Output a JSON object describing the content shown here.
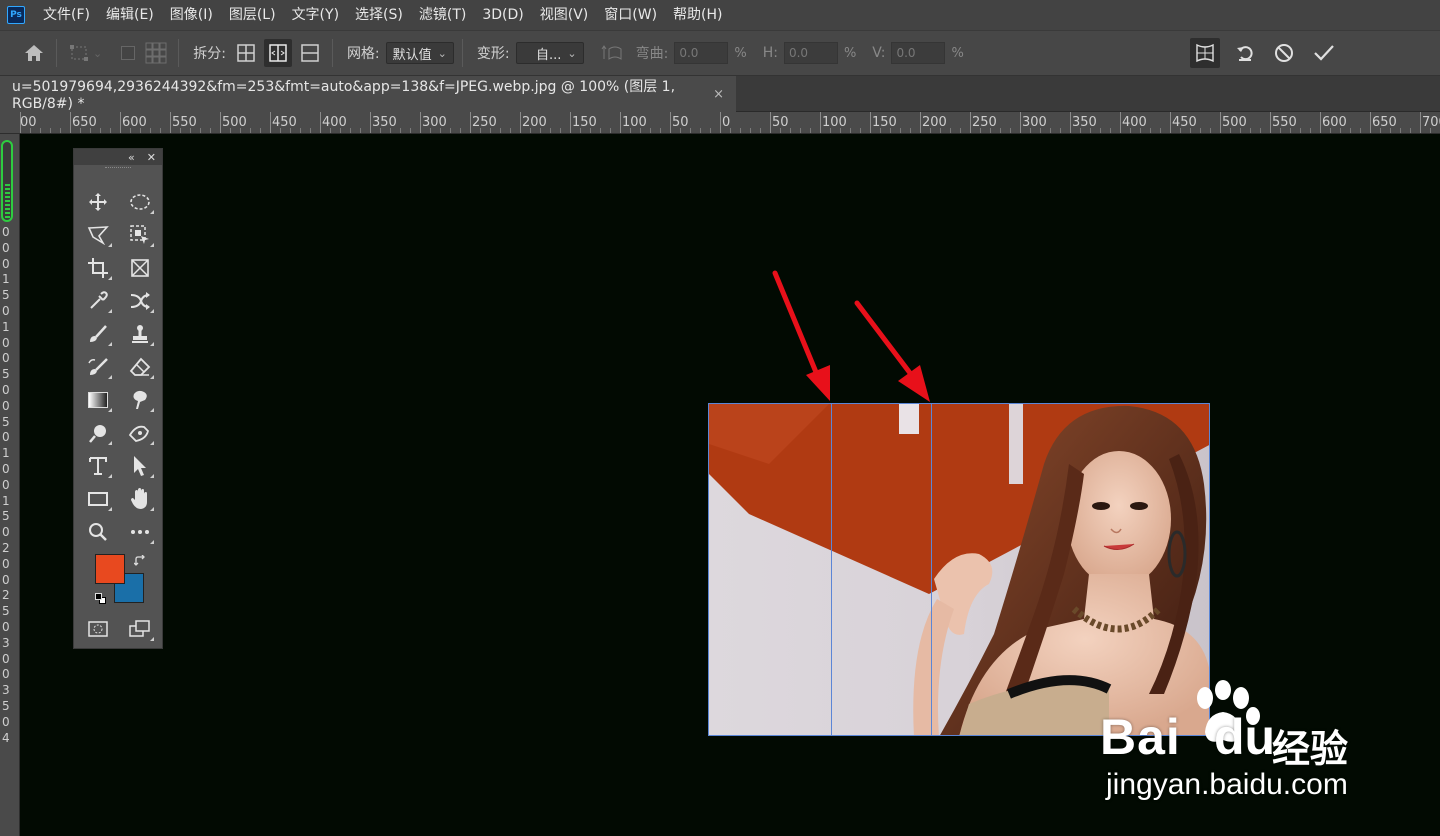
{
  "app": {
    "logo_text": "Ps",
    "menu": [
      "文件(F)",
      "编辑(E)",
      "图像(I)",
      "图层(L)",
      "文字(Y)",
      "选择(S)",
      "滤镜(T)",
      "3D(D)",
      "视图(V)",
      "窗口(W)",
      "帮助(H)"
    ]
  },
  "options": {
    "split_label": "拆分:",
    "grid_label": "网格:",
    "grid_value": "默认值",
    "warp_label": "变形:",
    "warp_value": "自...",
    "bend_label": "弯曲:",
    "bend_value": "0.0",
    "h_label": "H:",
    "h_value": "0.0",
    "v_label": "V:",
    "v_value": "0.0",
    "percent": "%"
  },
  "document": {
    "tab_title": "u=501979694,2936244392&fm=253&fmt=auto&app=138&f=JPEG.webp.jpg @ 100% (图层 1, RGB/8#) *",
    "close_glyph": "×"
  },
  "ruler": {
    "top_labels": [
      "00",
      "650",
      "600",
      "550",
      "500",
      "450",
      "400",
      "350",
      "300",
      "250",
      "200",
      "150",
      "100",
      "50",
      "0",
      "50",
      "100",
      "150",
      "200",
      "250",
      "300",
      "350",
      "400",
      "450",
      "500",
      "550",
      "600",
      "650",
      "700"
    ],
    "left_labels": [
      "0",
      "0",
      "0",
      "1",
      "5",
      "0",
      "1",
      "0",
      "0",
      "5",
      "0",
      "0",
      "5",
      "0",
      "1",
      "0",
      "0",
      "1",
      "5",
      "0",
      "2",
      "0",
      "0",
      "2",
      "5",
      "0",
      "3",
      "0",
      "0",
      "3",
      "5",
      "0",
      "4"
    ]
  },
  "toolbox": {
    "collapse_glyph": "«",
    "close_glyph": "✕",
    "foreground_color": "#e8491f",
    "background_color": "#1a6fa8"
  },
  "watermark": {
    "brand": "Bai",
    "brand_suffix": "du",
    "product": "经验",
    "url": "jingyan.baidu.com"
  },
  "colors": {
    "canvas_bg": "#020a02",
    "guide": "#5b86d6",
    "arrow": "#e8101a"
  }
}
